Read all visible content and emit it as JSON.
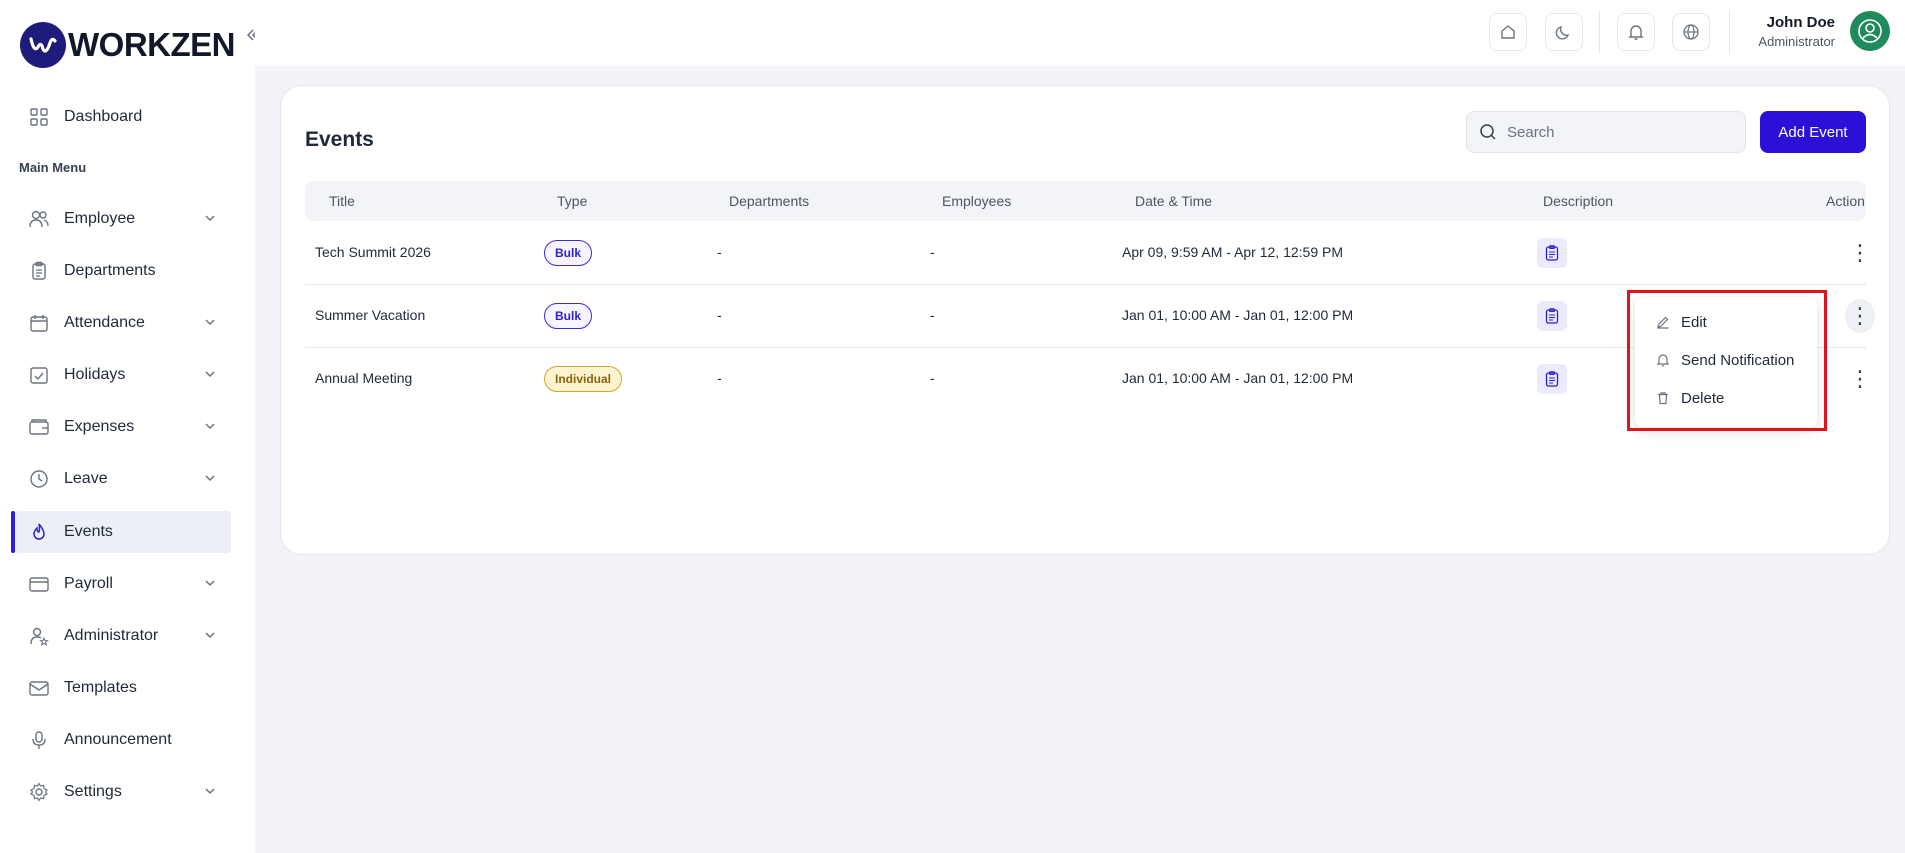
{
  "brand": {
    "name": "WORKZEN"
  },
  "sidebar": {
    "section_label": "Main Menu",
    "items": [
      {
        "label": "Dashboard",
        "icon": "grid-icon",
        "expandable": false
      },
      {
        "label": "Employee",
        "icon": "users-icon",
        "expandable": true
      },
      {
        "label": "Departments",
        "icon": "clipboard-icon",
        "expandable": false
      },
      {
        "label": "Attendance",
        "icon": "calendar-icon",
        "expandable": true
      },
      {
        "label": "Holidays",
        "icon": "calendar-check-icon",
        "expandable": true
      },
      {
        "label": "Expenses",
        "icon": "wallet-icon",
        "expandable": true
      },
      {
        "label": "Leave",
        "icon": "clock-icon",
        "expandable": true
      },
      {
        "label": "Events",
        "icon": "flame-icon",
        "expandable": false,
        "active": true
      },
      {
        "label": "Payroll",
        "icon": "card-icon",
        "expandable": true
      },
      {
        "label": "Administrator",
        "icon": "user-star-icon",
        "expandable": true
      },
      {
        "label": "Templates",
        "icon": "mail-icon",
        "expandable": false
      },
      {
        "label": "Announcement",
        "icon": "mic-icon",
        "expandable": false
      },
      {
        "label": "Settings",
        "icon": "gear-icon",
        "expandable": true
      }
    ]
  },
  "topbar": {
    "user_name": "John Doe",
    "user_role": "Administrator"
  },
  "main": {
    "title": "Events",
    "search_placeholder": "Search",
    "add_button_label": "Add Event",
    "columns": [
      "Title",
      "Type",
      "Departments",
      "Employees",
      "Date & Time",
      "Description",
      "Action"
    ],
    "rows": [
      {
        "title": "Tech Summit 2026",
        "type": "Bulk",
        "departments": "-",
        "employees": "-",
        "datetime": "Apr 09, 9:59 AM - Apr 12, 12:59 PM"
      },
      {
        "title": "Summer Vacation",
        "type": "Bulk",
        "departments": "-",
        "employees": "-",
        "datetime": "Jan 01, 10:00 AM - Jan 01, 12:00 PM"
      },
      {
        "title": "Annual Meeting",
        "type": "Individual",
        "departments": "-",
        "employees": "-",
        "datetime": "Jan 01, 10:00 AM - Jan 01, 12:00 PM"
      }
    ]
  },
  "action_menu": {
    "items": [
      {
        "label": "Edit",
        "icon": "pencil-icon"
      },
      {
        "label": "Send Notification",
        "icon": "bell-icon"
      },
      {
        "label": "Delete",
        "icon": "trash-icon"
      }
    ]
  },
  "colors": {
    "accent": "#2d10d8",
    "highlight": "#e0121a",
    "avatar": "#1f8a5a"
  }
}
